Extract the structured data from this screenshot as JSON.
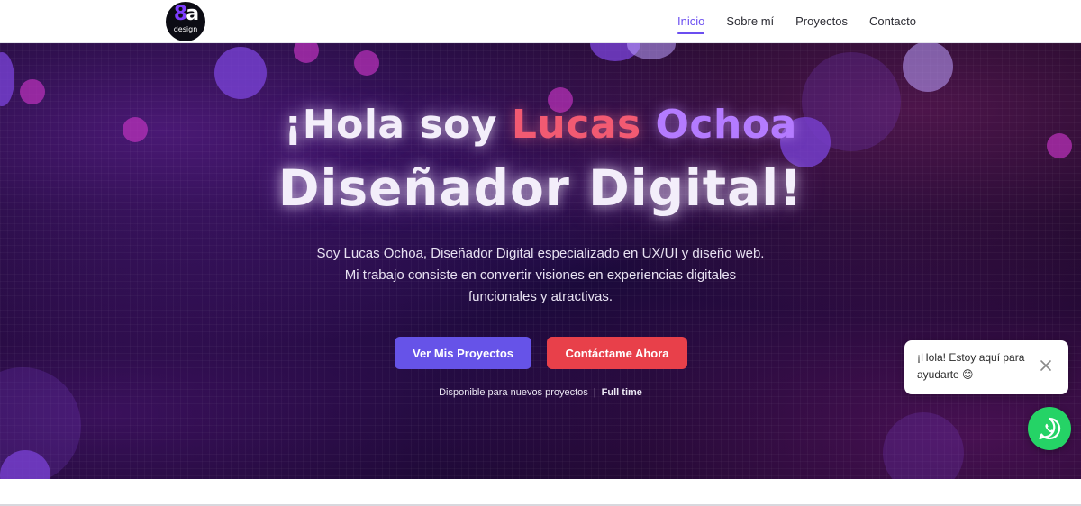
{
  "logo": {
    "mark_a": "8",
    "mark_b": "a",
    "sub": "design"
  },
  "nav": {
    "items": [
      {
        "label": "Inicio",
        "active": true
      },
      {
        "label": "Sobre mí",
        "active": false
      },
      {
        "label": "Proyectos",
        "active": false
      },
      {
        "label": "Contacto",
        "active": false
      }
    ]
  },
  "hero": {
    "title_prefix": "¡Hola soy ",
    "name_first": "Lucas",
    "name_last": "Ochoa",
    "title_line2": "Diseñador Digital!",
    "description": "Soy Lucas Ochoa, Diseñador Digital especializado en UX/UI y diseño web. Mi trabajo consiste en convertir visiones en experiencias digitales funcionales y atractivas.",
    "primary_button": "Ver Mis Proyectos",
    "secondary_button": "Contáctame Ahora",
    "availability_text": "Disponible para nuevos proyectos",
    "availability_separator": "|",
    "availability_type": "Full time"
  },
  "chat": {
    "greeting": "¡Hola! Estoy aquí para ayudarte 😊",
    "close_icon": "close-icon",
    "whatsapp_icon": "whatsapp-icon"
  },
  "colors": {
    "accent": "#6653e8",
    "secondary": "#e8404a",
    "whatsapp": "#25d366",
    "name_first": "#f25a72",
    "name_last": "#b47bff"
  }
}
